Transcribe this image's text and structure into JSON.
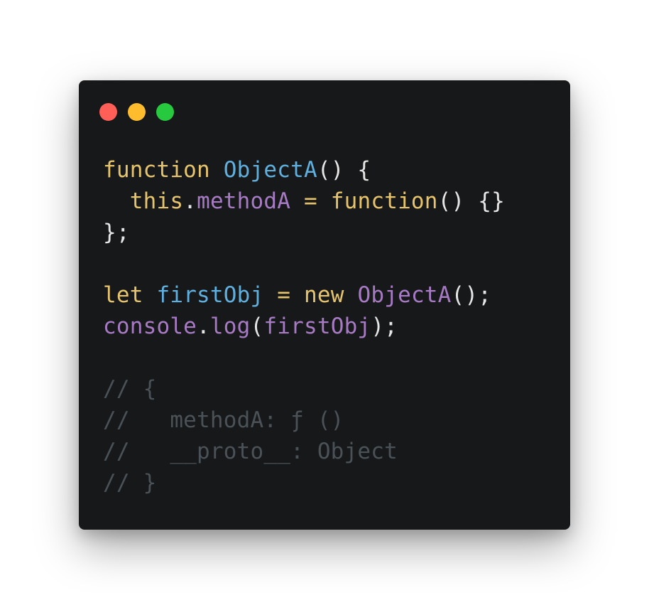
{
  "window": {
    "buttons": [
      {
        "name": "close",
        "color": "#ff5f56"
      },
      {
        "name": "minimize",
        "color": "#ffbd2e"
      },
      {
        "name": "zoom",
        "color": "#27c93f"
      }
    ]
  },
  "colors": {
    "keyword": "#e6c46d",
    "function_name": "#5fb0de",
    "property": "#a77bc4",
    "plain": "#e6e6e6",
    "comment": "#4a5258"
  },
  "code": {
    "lines": [
      [
        {
          "text": "function",
          "kind": "keyword"
        },
        {
          "text": " ",
          "kind": "plain"
        },
        {
          "text": "ObjectA",
          "kind": "function_name"
        },
        {
          "text": "() {",
          "kind": "plain"
        }
      ],
      [
        {
          "text": "  ",
          "kind": "plain"
        },
        {
          "text": "this",
          "kind": "keyword"
        },
        {
          "text": ".",
          "kind": "plain"
        },
        {
          "text": "methodA",
          "kind": "property"
        },
        {
          "text": " ",
          "kind": "plain"
        },
        {
          "text": "=",
          "kind": "keyword"
        },
        {
          "text": " ",
          "kind": "plain"
        },
        {
          "text": "function",
          "kind": "keyword"
        },
        {
          "text": "() {}",
          "kind": "plain"
        }
      ],
      [
        {
          "text": "};",
          "kind": "plain"
        }
      ],
      [],
      [
        {
          "text": "let",
          "kind": "keyword"
        },
        {
          "text": " ",
          "kind": "plain"
        },
        {
          "text": "firstObj",
          "kind": "function_name"
        },
        {
          "text": " ",
          "kind": "plain"
        },
        {
          "text": "=",
          "kind": "keyword"
        },
        {
          "text": " ",
          "kind": "plain"
        },
        {
          "text": "new",
          "kind": "keyword"
        },
        {
          "text": " ",
          "kind": "plain"
        },
        {
          "text": "ObjectA",
          "kind": "property"
        },
        {
          "text": "();",
          "kind": "plain"
        }
      ],
      [
        {
          "text": "console",
          "kind": "property"
        },
        {
          "text": ".",
          "kind": "plain"
        },
        {
          "text": "log",
          "kind": "property"
        },
        {
          "text": "(",
          "kind": "plain"
        },
        {
          "text": "firstObj",
          "kind": "property"
        },
        {
          "text": ");",
          "kind": "plain"
        }
      ],
      [],
      [
        {
          "text": "// {",
          "kind": "comment"
        }
      ],
      [
        {
          "text": "//   methodA: ƒ ()",
          "kind": "comment"
        }
      ],
      [
        {
          "text": "//   __proto__: Object",
          "kind": "comment"
        }
      ],
      [
        {
          "text": "// }",
          "kind": "comment"
        }
      ]
    ]
  }
}
